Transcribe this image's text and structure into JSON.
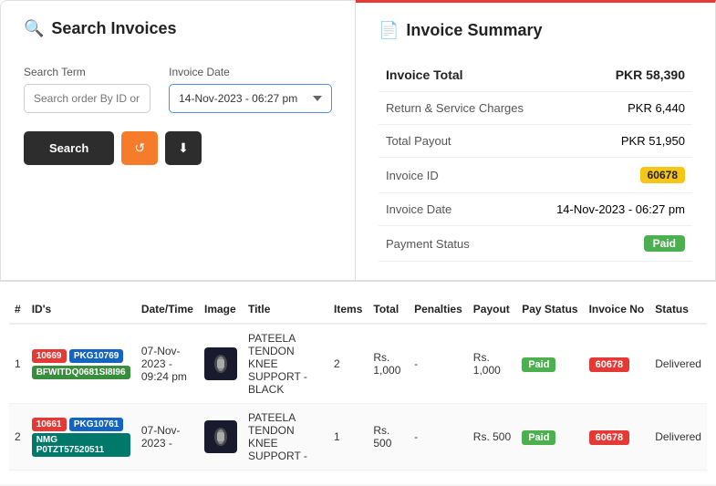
{
  "leftPanel": {
    "title": "Search Invoices",
    "searchTermLabel": "Search Term",
    "searchTermPlaceholder": "Search order By ID or CN",
    "invoiceDateLabel": "Invoice Date",
    "invoiceDateValue": "14-Nov-2023 - 06:27 pm",
    "searchButtonLabel": "Search",
    "refreshButtonLabel": "↺",
    "downloadButtonLabel": "⬇"
  },
  "rightPanel": {
    "title": "Invoice Summary",
    "rows": [
      {
        "label": "Invoice Total",
        "value": "PKR 58,390",
        "badge": null
      },
      {
        "label": "Return & Service Charges",
        "value": "PKR 6,440",
        "badge": null
      },
      {
        "label": "Total Payout",
        "value": "PKR 51,950",
        "badge": null
      },
      {
        "label": "Invoice ID",
        "value": null,
        "badge": "60678",
        "badgeType": "yellow"
      },
      {
        "label": "Invoice Date",
        "value": "14-Nov-2023 - 06:27 pm",
        "badge": null
      },
      {
        "label": "Payment Status",
        "value": null,
        "badge": "Paid",
        "badgeType": "green"
      }
    ]
  },
  "table": {
    "columns": [
      "#",
      "ID's",
      "Date/Time",
      "Image",
      "Title",
      "Items",
      "Total",
      "Penalties",
      "Payout",
      "Pay Status",
      "Invoice No",
      "Status"
    ],
    "rows": [
      {
        "num": "1",
        "ids": [
          "10669",
          "PKG10769",
          "BFWITDQ0681SI8I96"
        ],
        "idBadges": [
          "red",
          "blue",
          "green"
        ],
        "datetime": "07-Nov-2023 - 09:24 pm",
        "title": "PATEELA TENDON KNEE SUPPORT - BLACK",
        "items": "2",
        "total": "Rs. 1,000",
        "penalties": "-",
        "payout": "Rs. 1,000",
        "payStatus": "Paid",
        "invoiceNo": "60678",
        "status": "Delivered"
      },
      {
        "num": "2",
        "ids": [
          "10661",
          "PKG10761",
          "NMG P0TZT57520511"
        ],
        "idBadges": [
          "red",
          "blue",
          "teal"
        ],
        "datetime": "07-Nov-2023 -",
        "title": "PATEELA TENDON KNEE SUPPORT -",
        "items": "1",
        "total": "Rs. 500",
        "penalties": "-",
        "payout": "Rs. 500",
        "payStatus": "Paid",
        "invoiceNo": "60678",
        "status": "Delivered"
      }
    ]
  }
}
